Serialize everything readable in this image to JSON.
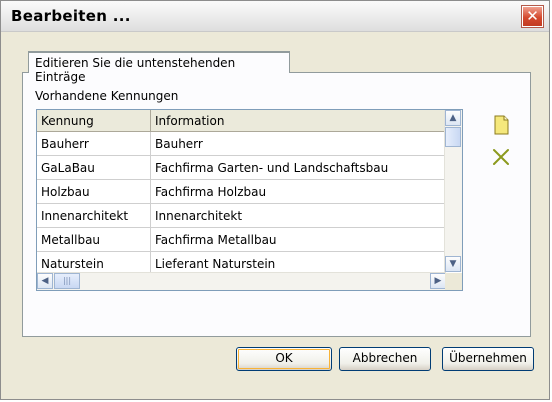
{
  "window": {
    "title": "Bearbeiten ...",
    "close_glyph": "✕"
  },
  "tab": {
    "label": "Editieren Sie die untenstehenden Einträge"
  },
  "group": {
    "label": "Vorhandene Kennungen"
  },
  "table": {
    "columns": [
      "Kennung",
      "Information"
    ],
    "rows": [
      [
        "Bauherr",
        "Bauherr"
      ],
      [
        "GaLaBau",
        "Fachfirma Garten- und Landschaftsbau"
      ],
      [
        "Holzbau",
        "Fachfirma Holzbau"
      ],
      [
        "Innenarchitekt",
        "Innenarchitekt"
      ],
      [
        "Metallbau",
        "Fachfirma Metallbau"
      ],
      [
        "Naturstein",
        "Lieferant Naturstein"
      ]
    ]
  },
  "side_buttons": {
    "new_icon": "new-document-icon",
    "delete_icon": "delete-x-icon"
  },
  "buttons": {
    "ok": "OK",
    "cancel": "Abbrechen",
    "apply": "Übernehmen"
  },
  "colors": {
    "close": "#d44a2f",
    "delete_icon": "#8c9a1e",
    "new_icon": "#f5e87c"
  }
}
